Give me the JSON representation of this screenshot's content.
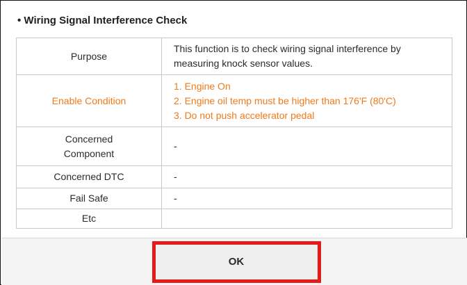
{
  "dialog": {
    "title": "• Wiring Signal Interference Check",
    "rows": [
      {
        "label": "Purpose",
        "lines": [
          "This function is to check wiring signal interference by",
          "measuring knock sensor values."
        ]
      },
      {
        "label": "Enable Condition",
        "lines": [
          "1. Engine On",
          "2. Engine oil temp must be higher than 176'F (80'C)",
          "3. Do not push accelerator pedal"
        ]
      },
      {
        "label_lines": [
          "Concerned",
          "Component"
        ],
        "lines": [
          "-"
        ]
      },
      {
        "label": "Concerned DTC",
        "lines": [
          "-"
        ]
      },
      {
        "label": "Fail Safe",
        "lines": [
          "-"
        ]
      },
      {
        "label": "Etc",
        "lines": [
          ""
        ]
      }
    ],
    "ok_label": "OK"
  },
  "colors": {
    "highlight_text": "#f07a1a",
    "annotation_box": "#e51b1b",
    "text": "#2b2b2b",
    "footer_bg": "#f4f4f4"
  }
}
